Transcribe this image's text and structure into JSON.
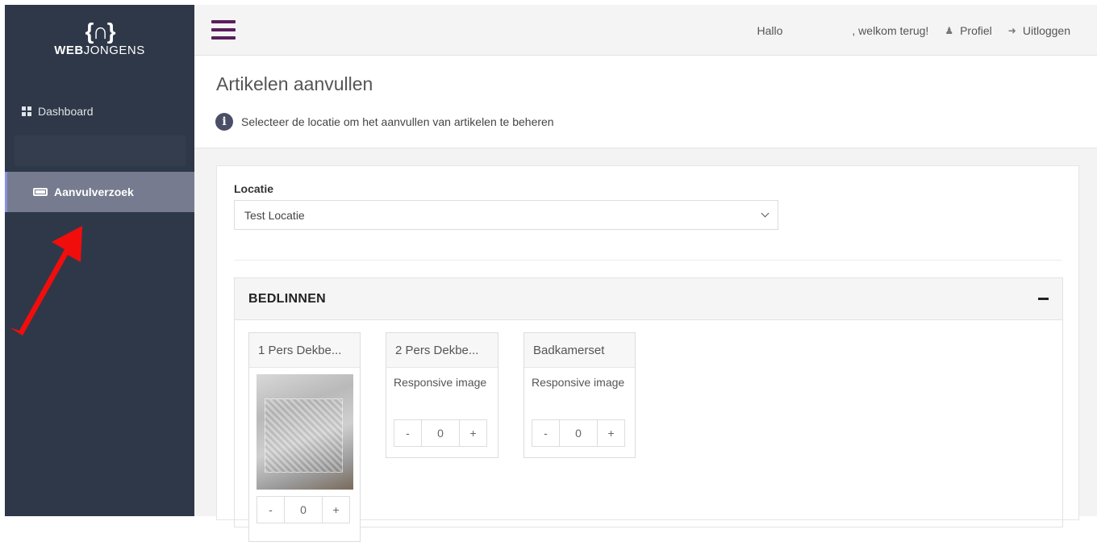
{
  "brand": {
    "mark": "{∩}",
    "bold": "WEB",
    "rest": "JONGENS"
  },
  "sidebar": {
    "items": [
      {
        "label": "Dashboard",
        "icon": "grid-icon"
      },
      {
        "label": "Aanvulverzoek",
        "icon": "battery-icon",
        "active": true
      }
    ],
    "active_color": "#767b8f"
  },
  "topbar": {
    "greeting_prefix": "Hallo",
    "greeting_suffix": ", welkom terug!",
    "profile": "Profiel",
    "logout": "Uitloggen",
    "accent": "#5b1e5e"
  },
  "page": {
    "title": "Artikelen aanvullen",
    "info": "Selecteer de locatie om het aanvullen van artikelen te beheren"
  },
  "location": {
    "label": "Locatie",
    "selected": "Test Locatie"
  },
  "section": {
    "title": "BEDLINNEN",
    "products": [
      {
        "name": "1 Pers Dekbe...",
        "image_alt": "",
        "quantity": "0",
        "minus": "-",
        "plus": "+"
      },
      {
        "name": "2 Pers Dekbe...",
        "image_alt": "Responsive image",
        "quantity": "0",
        "minus": "-",
        "plus": "+"
      },
      {
        "name": "Badkamerset",
        "image_alt": "Responsive image",
        "quantity": "0",
        "minus": "-",
        "plus": "+"
      }
    ]
  }
}
